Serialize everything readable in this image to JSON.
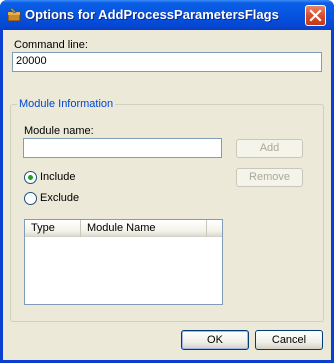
{
  "window": {
    "title": "Options for AddProcessParametersFlags",
    "icon": "app-tool-icon",
    "close_icon": "close-x-icon"
  },
  "command_line": {
    "label": "Command line:",
    "value": "20000"
  },
  "module_group": {
    "title": "Module Information",
    "name_label": "Module name:",
    "name_value": "",
    "add_label": "Add",
    "remove_label": "Remove",
    "include_label": "Include",
    "exclude_label": "Exclude",
    "selected": "include",
    "list_columns": [
      "Type",
      "Module Name"
    ],
    "list_rows": []
  },
  "buttons": {
    "ok_label": "OK",
    "cancel_label": "Cancel"
  },
  "colors": {
    "title_bar": "#0654e0",
    "dialog_bg": "#ece9d8",
    "group_title": "#0046d5",
    "radio_selected": "#21a121"
  }
}
